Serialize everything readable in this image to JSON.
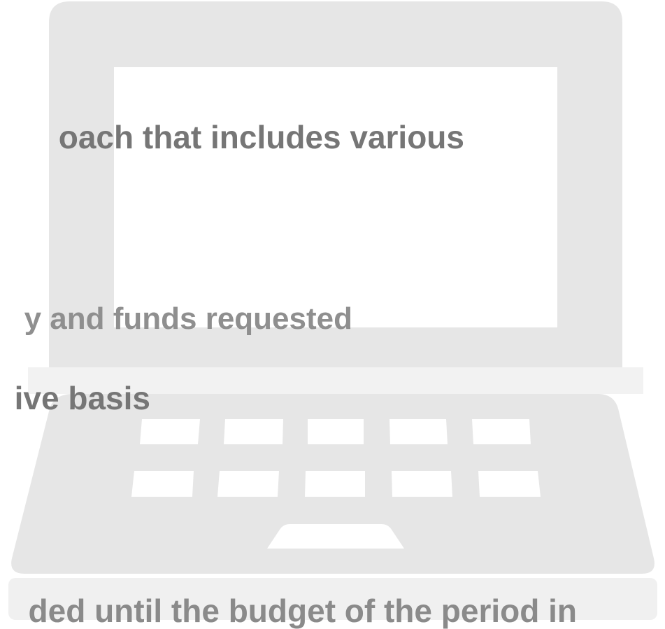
{
  "text_lines": [
    "oach that includes various",
    "y and funds requested",
    "ive basis",
    "ded until the budget of the period in"
  ],
  "colors": {
    "laptop_fill": "#e6e6e6",
    "laptop_shadow": "#f0f0f0",
    "screen_fill": "#ffffff",
    "key_fill": "#ffffff",
    "text_primary": "#767676",
    "text_faded": "#8f8f8f"
  },
  "icons": {
    "illustration": "laptop-icon"
  }
}
